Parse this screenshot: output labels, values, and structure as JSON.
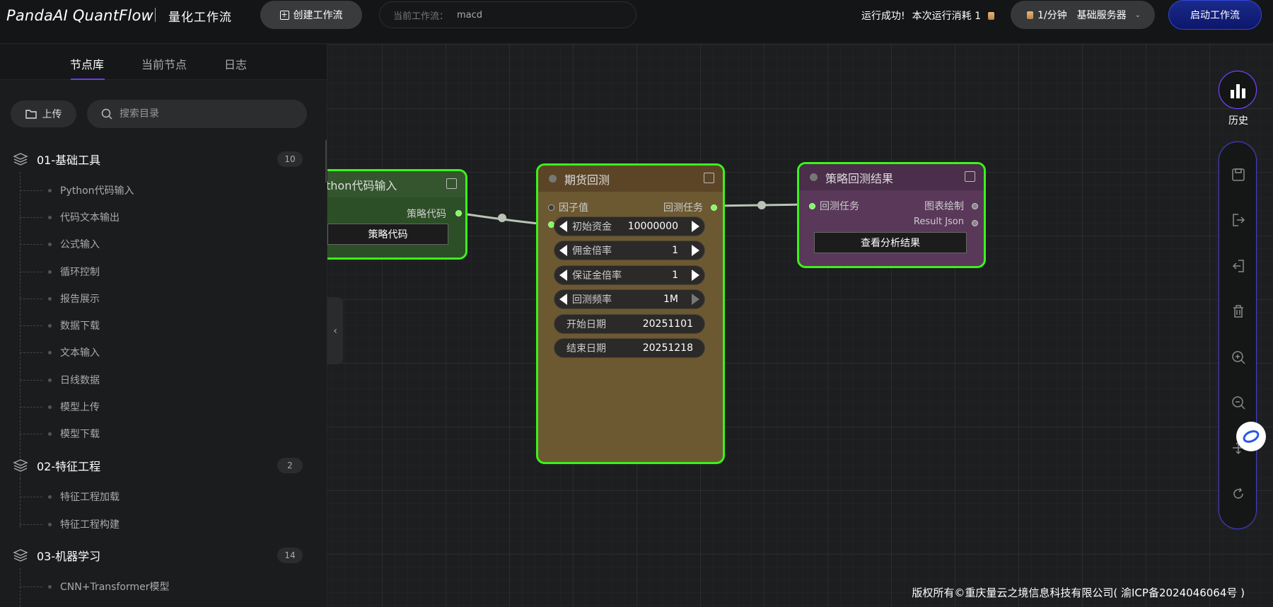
{
  "header": {
    "logo": "PandaAI QuantFlow",
    "subtitle": "量化工作流",
    "create_button": "创建工作流",
    "current_workflow_label": "当前工作流：",
    "current_workflow_value": "macd",
    "run_status": "运行成功!",
    "run_cost": "本次运行消耗 1",
    "server_rate": "1/分钟",
    "server_name": "基础服务器",
    "start_button": "启动工作流"
  },
  "sidebar": {
    "tabs": [
      "节点库",
      "当前节点",
      "日志"
    ],
    "active_tab": "节点库",
    "upload_button": "上传",
    "search_placeholder": "搜索目录",
    "groups": [
      {
        "title": "01-基础工具",
        "count": "10",
        "items": [
          "Python代码输入",
          "代码文本输出",
          "公式输入",
          "循环控制",
          "报告展示",
          "数据下载",
          "文本输入",
          "日线数据",
          "模型上传",
          "模型下载"
        ]
      },
      {
        "title": "02-特征工程",
        "count": "2",
        "items": [
          "特征工程加载",
          "特征工程构建"
        ]
      },
      {
        "title": "03-机器学习",
        "count": "14",
        "items": [
          "CNN+Transformer模型"
        ]
      }
    ]
  },
  "nodes": {
    "python_input": {
      "title": "thon代码输入",
      "output_port": "策略代码",
      "button": "策略代码"
    },
    "futures_backtest": {
      "title": "期货回测",
      "input_port": "因子值",
      "output_port": "回测任务",
      "params": [
        {
          "name": "初始资金",
          "value": "10000000"
        },
        {
          "name": "佣金倍率",
          "value": "1"
        },
        {
          "name": "保证金倍率",
          "value": "1"
        },
        {
          "name": "回测频率",
          "value": "1M"
        }
      ],
      "dates": [
        {
          "name": "开始日期",
          "value": "20251101"
        },
        {
          "name": "结束日期",
          "value": "20251218"
        }
      ]
    },
    "backtest_result": {
      "title": "策略回测结果",
      "input_port": "回测任务",
      "output_port_1": "图表绘制",
      "output_port_2": "Result Json",
      "button": "查看分析结果"
    }
  },
  "right_toolbar": {
    "history_label": "历史",
    "tools": [
      "save-icon",
      "export-icon",
      "import-icon",
      "delete-icon",
      "zoom-in-icon",
      "zoom-out-icon",
      "fit-icon",
      "refresh-icon"
    ]
  },
  "footer": {
    "copyright": "版权所有©重庆量云之境信息科技有限公司( 渝ICP备2024046064号 )"
  },
  "colors": {
    "node_border": "#3cf21c",
    "python_node_bg": "#3f6b35",
    "backtest_node_bg": "#6d5a35",
    "result_node_bg": "#5c3a5c",
    "accent": "#6b3cf0"
  }
}
